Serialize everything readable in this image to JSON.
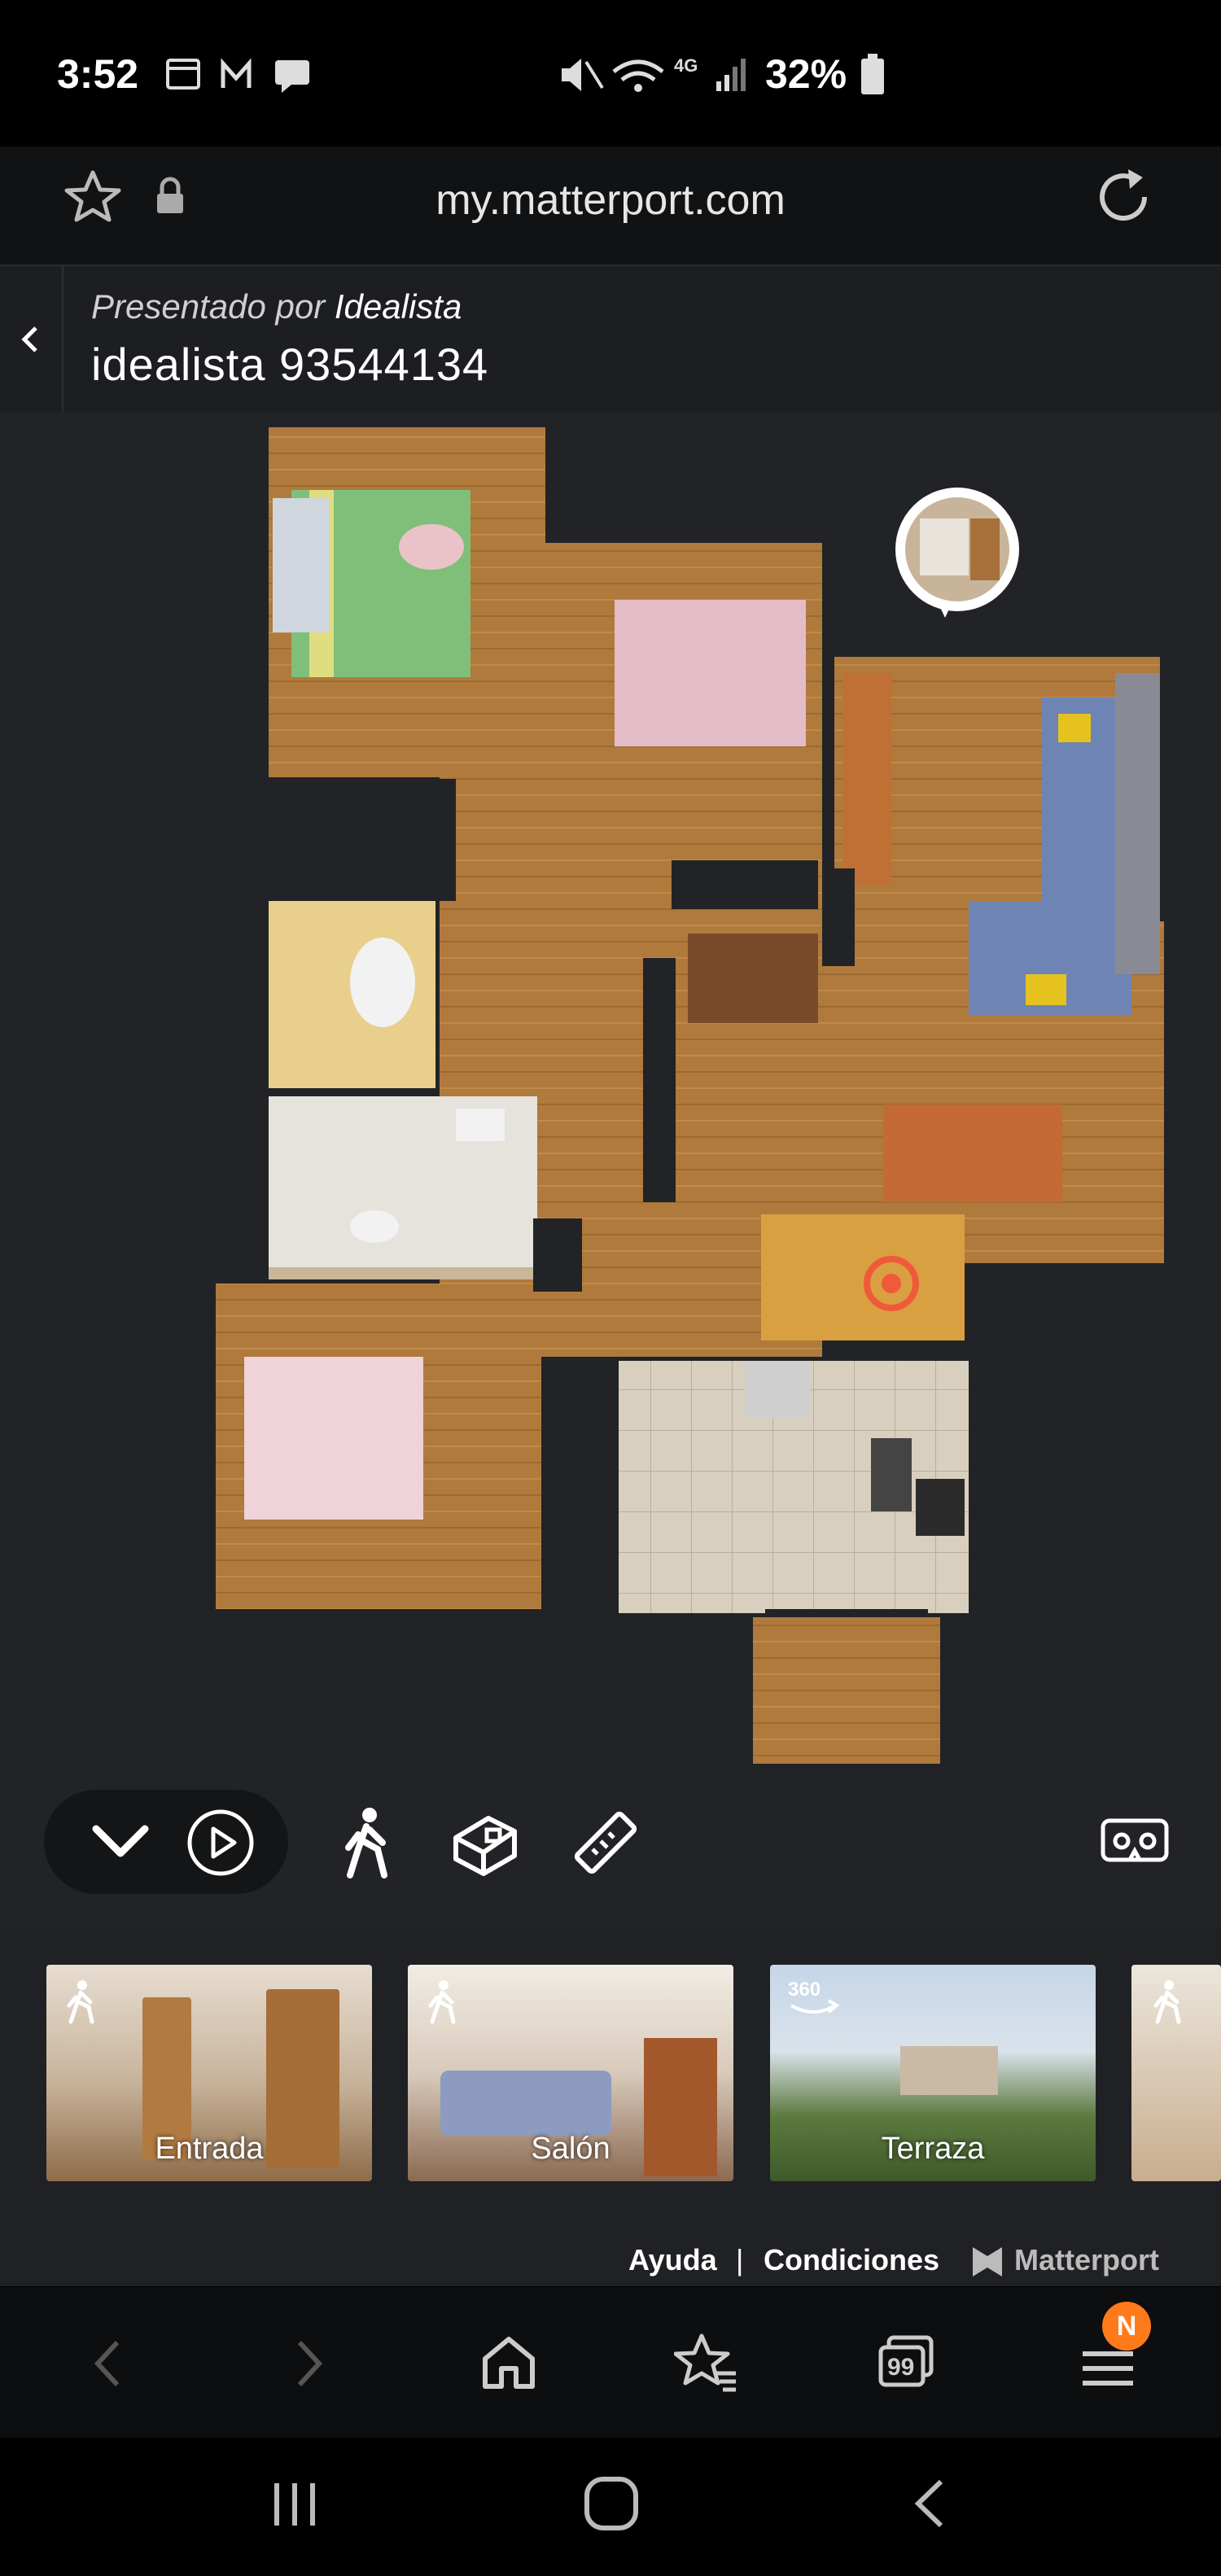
{
  "status_bar": {
    "time": "3:52",
    "network": "4G",
    "battery": "32%"
  },
  "url_bar": {
    "url": "my.matterport.com"
  },
  "header": {
    "presented_by_prefix": "Presentado por",
    "presented_by_name": "Idealista",
    "title": "idealista 93544134"
  },
  "tour_thumbnails": [
    {
      "label": "Entrada",
      "icon": "walk-icon"
    },
    {
      "label": "Salón",
      "icon": "walk-icon"
    },
    {
      "label": "Terraza",
      "icon": "360-icon",
      "icon_text": "360"
    },
    {
      "label": "",
      "icon": "walk-icon"
    }
  ],
  "footer": {
    "help": "Ayuda",
    "separator": "|",
    "terms": "Condiciones",
    "brand": "Matterport"
  },
  "browser_bar": {
    "tabs_count": "99",
    "menu_badge": "N"
  },
  "colors": {
    "accent": "#ff7a1a",
    "target": "#f05a3a",
    "map_bg": "#222326"
  }
}
